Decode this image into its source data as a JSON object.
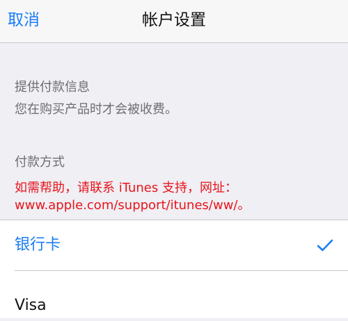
{
  "nav": {
    "cancel_label": "取消",
    "title": "帐户设置"
  },
  "payment_info": {
    "heading": "提供付款信息",
    "description": "您在购买产品时才会被收费。"
  },
  "payment_method": {
    "heading": "付款方式",
    "help_line_1": "如需帮助，请联系 iTunes 支持，网址：",
    "help_line_2": "www.apple.com/support/itunes/ww/。"
  },
  "options": [
    {
      "label": "银行卡",
      "selected": true
    },
    {
      "label": "Visa",
      "selected": false
    }
  ],
  "colors": {
    "accent": "#1b7ef5",
    "help_text": "#e8141b",
    "secondary_text": "#6d6d72",
    "background": "#efeff4"
  },
  "icons": {
    "selected_marker": "check-icon"
  }
}
